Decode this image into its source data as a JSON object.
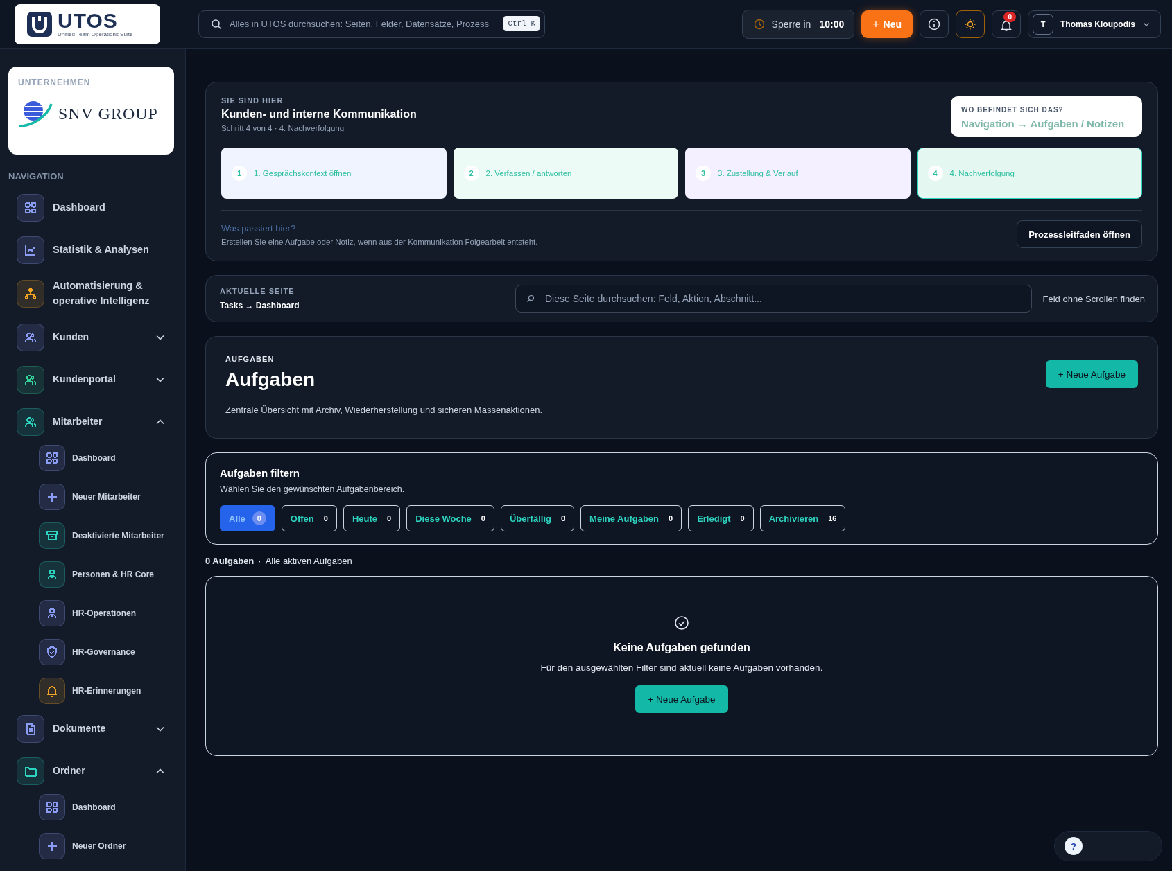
{
  "header": {
    "logo": {
      "name": "UTOS",
      "tagline": "Unified Team Operations Suite"
    },
    "search": {
      "placeholder": "Alles in UTOS durchsuchen: Seiten, Felder, Datensätze, Prozess",
      "shortcut": "Ctrl K"
    },
    "lock": {
      "label": "Sperre in",
      "time": "10:00"
    },
    "new_button": {
      "icon": "+",
      "label": "Neu"
    },
    "notifications": {
      "count": "0"
    },
    "user": {
      "initial": "T",
      "name": "Thomas Kloupodis"
    }
  },
  "sidebar": {
    "company": {
      "label": "UNTERNEHMEN",
      "name": "SNV GROUP"
    },
    "nav_label": "NAVIGATION",
    "items": [
      {
        "label": "Dashboard",
        "color": "#8b9cf5"
      },
      {
        "label": "Statistik & Analysen",
        "color": "#8b9cf5"
      },
      {
        "label": "Automatisierung & operative Intelligenz",
        "color": "#f5a524"
      },
      {
        "label": "Kunden",
        "color": "#8b9cf5",
        "expanded": false
      },
      {
        "label": "Kundenportal",
        "color": "#34d399",
        "expanded": false
      },
      {
        "label": "Mitarbeiter",
        "color": "#2dd4bf",
        "expanded": true,
        "children": [
          {
            "label": "Dashboard",
            "color": "#8b9cf5"
          },
          {
            "label": "Neuer Mitarbeiter",
            "color": "#8b9cf5"
          },
          {
            "label": "Deaktivierte Mitarbeiter",
            "color": "#2dd4bf"
          },
          {
            "label": "Personen & HR Core",
            "color": "#2dd4bf"
          },
          {
            "label": "HR-Operationen",
            "color": "#8b9cf5"
          },
          {
            "label": "HR-Governance",
            "color": "#8b9cf5"
          },
          {
            "label": "HR-Erinnerungen",
            "color": "#f5a524"
          }
        ]
      },
      {
        "label": "Dokumente",
        "color": "#8b9cf5",
        "expanded": false
      },
      {
        "label": "Ordner",
        "color": "#2dd4bf",
        "expanded": true,
        "children": [
          {
            "label": "Dashboard",
            "color": "#8b9cf5"
          },
          {
            "label": "Neuer Ordner",
            "color": "#8b9cf5"
          }
        ]
      }
    ]
  },
  "process": {
    "eyebrow": "SIE SIND HIER",
    "title": "Kunden- und interne Kommunikation",
    "subtitle": "Schritt 4 von 4 · 4. Nachverfolgung",
    "where": {
      "label": "WO BEFINDET SICH DAS?",
      "path": "Navigation → Aufgaben / Notizen"
    },
    "steps": [
      {
        "number": "1",
        "label": "1. Gesprächskontext öffnen",
        "color": "#eff4ff",
        "selected": false
      },
      {
        "number": "2",
        "label": "2. Verfassen / antworten",
        "color": "#ecfbf6",
        "selected": false
      },
      {
        "number": "3",
        "label": "3. Zustellung & Verlauf",
        "color": "#f5f0ff",
        "selected": false
      },
      {
        "number": "4",
        "label": "4. Nachverfolgung",
        "color": "#e4f8f1",
        "selected": true
      }
    ],
    "question": "Was passiert hier?",
    "explanation": "Erstellen Sie eine Aufgabe oder Notiz, wenn aus der Kommunikation Folgearbeit entsteht.",
    "guide_button": "Prozessleitfaden öffnen"
  },
  "current_page": {
    "eyebrow": "AKTUELLE SEITE",
    "path": "Tasks → Dashboard",
    "search_placeholder": "Diese Seite durchsuchen: Feld, Aktion, Abschnitt...",
    "hint": "Feld ohne Scrollen finden"
  },
  "page_header": {
    "eyebrow": "AUFGABEN",
    "title": "Aufgaben",
    "description": "Zentrale Übersicht mit Archiv, Wiederherstellung und sicheren Massenaktionen.",
    "button": "+ Neue Aufgabe"
  },
  "filter": {
    "title": "Aufgaben filtern",
    "subtitle": "Wählen Sie den gewünschten Aufgabenbereich.",
    "chips": [
      {
        "label": "Alle",
        "count": "0",
        "selected": true
      },
      {
        "label": "Offen",
        "count": "0",
        "selected": false
      },
      {
        "label": "Heute",
        "count": "0",
        "selected": false
      },
      {
        "label": "Diese Woche",
        "count": "0",
        "selected": false
      },
      {
        "label": "Überfällig",
        "count": "0",
        "selected": false
      },
      {
        "label": "Meine Aufgaben",
        "count": "0",
        "selected": false
      },
      {
        "label": "Erledigt",
        "count": "0",
        "selected": false
      },
      {
        "label": "Archivieren",
        "count": "16",
        "selected": false
      }
    ]
  },
  "summary": {
    "count": "0 Aufgaben",
    "separator": "·",
    "scope": "Alle aktiven Aufgaben"
  },
  "empty": {
    "title": "Keine Aufgaben gefunden",
    "text": "Für den ausgewählten Filter sind aktuell keine Aufgaben vorhanden.",
    "button": "+ Neue Aufgabe"
  },
  "help": {
    "icon": "?"
  }
}
